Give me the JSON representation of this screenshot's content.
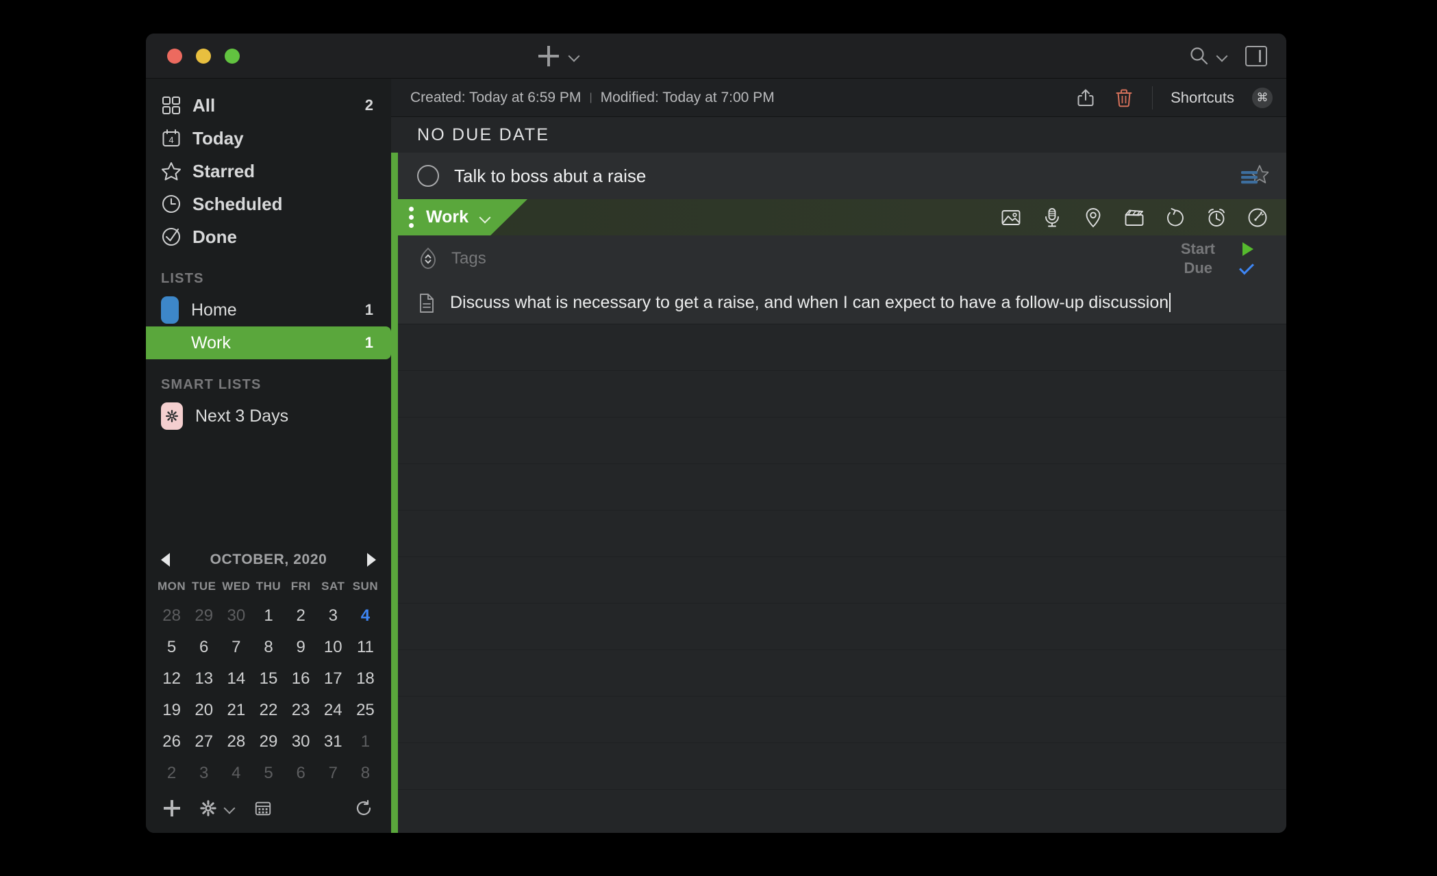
{
  "window": {
    "traffic_lights": [
      "close",
      "minimize",
      "zoom"
    ],
    "colors": {
      "accent_green": "#5aa73c",
      "accent_blue": "#3e86f5",
      "list_home": "#3d87c9",
      "smart_list_pink": "#f4cfcf",
      "trash_red": "#d4705a"
    }
  },
  "toolbar": {
    "add_label": "add-task",
    "add_dropdown_label": "add-options",
    "search_label": "search",
    "search_dropdown_label": "search-options",
    "panel_toggle_label": "toggle-sidebar"
  },
  "sidebar": {
    "nav": [
      {
        "label": "All",
        "icon": "grid-icon",
        "count": "2"
      },
      {
        "label": "Today",
        "icon": "calendar-icon",
        "count": ""
      },
      {
        "label": "Starred",
        "icon": "star-icon",
        "count": ""
      },
      {
        "label": "Scheduled",
        "icon": "clock-icon",
        "count": ""
      },
      {
        "label": "Done",
        "icon": "check-circle-icon",
        "count": ""
      }
    ],
    "today_icon_number": "4",
    "lists_header": "LISTS",
    "lists": [
      {
        "label": "Home",
        "count": "1",
        "color": "#3d87c9",
        "selected": false
      },
      {
        "label": "Work",
        "count": "1",
        "color": "#5aa73c",
        "selected": true
      }
    ],
    "smart_lists_header": "SMART LISTS",
    "smart_lists": [
      {
        "label": "Next 3 Days",
        "icon": "gear-icon",
        "badge_color": "#f4cfcf"
      }
    ]
  },
  "calendar": {
    "title": "OCTOBER, 2020",
    "prev_label": "previous-month",
    "next_label": "next-month",
    "day_headers": [
      "MON",
      "TUE",
      "WED",
      "THU",
      "FRI",
      "SAT",
      "SUN"
    ],
    "weeks": [
      [
        {
          "d": "28",
          "s": "muted"
        },
        {
          "d": "29",
          "s": "muted"
        },
        {
          "d": "30",
          "s": "muted"
        },
        {
          "d": "1",
          "s": ""
        },
        {
          "d": "2",
          "s": ""
        },
        {
          "d": "3",
          "s": ""
        },
        {
          "d": "4",
          "s": "today"
        }
      ],
      [
        {
          "d": "5",
          "s": ""
        },
        {
          "d": "6",
          "s": ""
        },
        {
          "d": "7",
          "s": ""
        },
        {
          "d": "8",
          "s": ""
        },
        {
          "d": "9",
          "s": ""
        },
        {
          "d": "10",
          "s": ""
        },
        {
          "d": "11",
          "s": ""
        }
      ],
      [
        {
          "d": "12",
          "s": ""
        },
        {
          "d": "13",
          "s": ""
        },
        {
          "d": "14",
          "s": ""
        },
        {
          "d": "15",
          "s": ""
        },
        {
          "d": "16",
          "s": ""
        },
        {
          "d": "17",
          "s": ""
        },
        {
          "d": "18",
          "s": ""
        }
      ],
      [
        {
          "d": "19",
          "s": ""
        },
        {
          "d": "20",
          "s": ""
        },
        {
          "d": "21",
          "s": ""
        },
        {
          "d": "22",
          "s": ""
        },
        {
          "d": "23",
          "s": ""
        },
        {
          "d": "24",
          "s": ""
        },
        {
          "d": "25",
          "s": ""
        }
      ],
      [
        {
          "d": "26",
          "s": ""
        },
        {
          "d": "27",
          "s": ""
        },
        {
          "d": "28",
          "s": ""
        },
        {
          "d": "29",
          "s": ""
        },
        {
          "d": "30",
          "s": ""
        },
        {
          "d": "31",
          "s": ""
        },
        {
          "d": "1",
          "s": "muted"
        }
      ],
      [
        {
          "d": "2",
          "s": "muted"
        },
        {
          "d": "3",
          "s": "muted"
        },
        {
          "d": "4",
          "s": "muted"
        },
        {
          "d": "5",
          "s": "muted"
        },
        {
          "d": "6",
          "s": "muted"
        },
        {
          "d": "7",
          "s": "muted"
        },
        {
          "d": "8",
          "s": "muted"
        }
      ]
    ],
    "toolbar": {
      "add_label": "add-list",
      "settings_label": "settings",
      "settings_dropdown_label": "settings-options",
      "calendar_view_label": "calendar-view",
      "sync_label": "sync"
    }
  },
  "main": {
    "meta": {
      "created": "Created: Today at 6:59 PM",
      "separator": "|",
      "modified": "Modified: Today at 7:00 PM"
    },
    "actions": {
      "share_label": "share",
      "delete_label": "delete",
      "shortcuts_label": "Shortcuts",
      "shortcuts_badge": "⌘"
    },
    "section_header": "NO DUE DATE",
    "task": {
      "title": "Talk to boss abut a raise",
      "completed": false,
      "list_ribbon": "Work",
      "ribbon_dropdown_label": "change-list",
      "attachment_icons": [
        "image-icon",
        "microphone-icon",
        "location-icon",
        "clapperboard-icon",
        "repeat-icon",
        "alarm-icon",
        "gauge-icon"
      ],
      "tags_placeholder": "Tags",
      "start_label": "Start",
      "due_label": "Due",
      "note": "Discuss what is necessary to get a raise, and when I can expect to have a follow-up discussion"
    }
  }
}
